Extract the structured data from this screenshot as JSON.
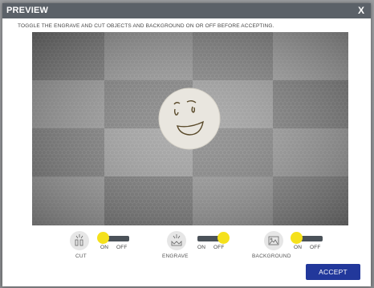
{
  "dialog": {
    "title": "PREVIEW",
    "close_label": "X",
    "instruction": "TOGGLE THE ENGRAVE AND CUT OBJECTS AND BACKGROUND ON OR OFF BEFORE ACCEPTING."
  },
  "controls": [
    {
      "name": "cut",
      "label": "CUT",
      "icon": "cut-icon",
      "on_label": "ON",
      "off_label": "OFF",
      "state": "on"
    },
    {
      "name": "engrave",
      "label": "ENGRAVE",
      "icon": "engrave-icon",
      "on_label": "ON",
      "off_label": "OFF",
      "state": "off"
    },
    {
      "name": "background",
      "label": "BACKGROUND",
      "icon": "background-image-icon",
      "on_label": "ON",
      "off_label": "OFF",
      "state": "on"
    }
  ],
  "accept_label": "ACCEPT",
  "colors": {
    "titlebar": "#5b6168",
    "accent_button": "#22389b",
    "toggle_knob": "#f5e11c",
    "toggle_track": "#4b5259"
  }
}
